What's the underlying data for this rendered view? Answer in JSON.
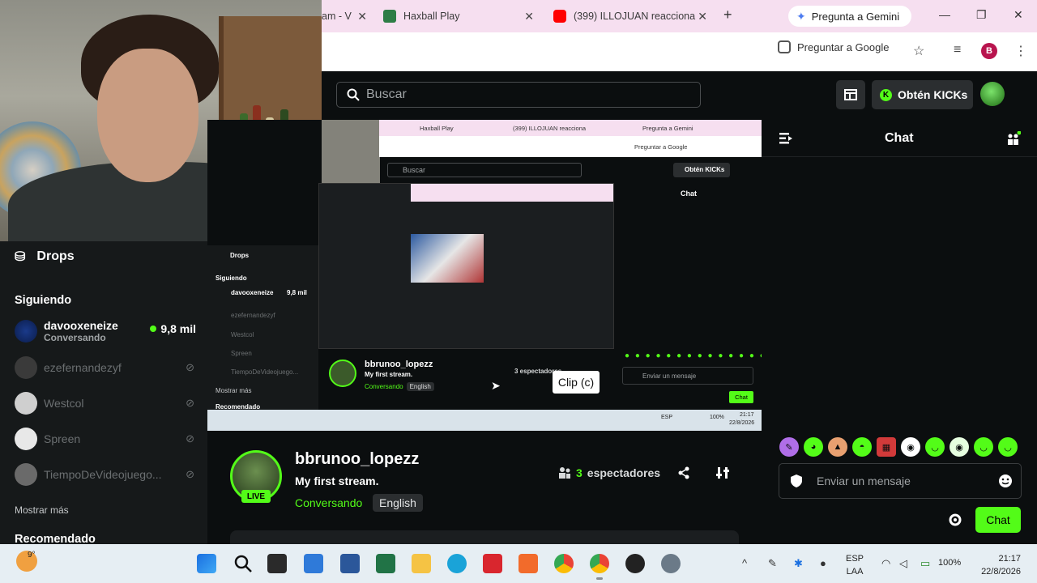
{
  "browser": {
    "tabs": [
      {
        "title": "am - V",
        "favicon_color": "#53fc18"
      },
      {
        "title": "Haxball Play",
        "favicon_color": "#2d7d46"
      },
      {
        "title": "(399) ILLOJUAN reacciona",
        "favicon_color": "#ff0000"
      }
    ],
    "new_tab": "+",
    "gemini": "Pregunta a Gemini",
    "ask_google": "Preguntar a Google",
    "profile_initial": "B"
  },
  "header": {
    "search_placeholder": "Buscar",
    "get_kicks": "Obtén KICKs"
  },
  "sidebar": {
    "drops": "Drops",
    "following_title": "Siguiendo",
    "channels": [
      {
        "name": "davooxeneize",
        "status": "Conversando",
        "viewers": "9,8 mil",
        "live": true
      },
      {
        "name": "ezefernandezyf",
        "live": false
      },
      {
        "name": "Westcol",
        "live": false
      },
      {
        "name": "Spreen",
        "live": false
      },
      {
        "name": "TiempoDeVideojuego...",
        "live": false
      }
    ],
    "show_more": "Mostrar más",
    "recommended_title": "Recomendado"
  },
  "video": {
    "nested_search": "Buscar",
    "nested_kicks": "Obtén KICKs",
    "nested_chat": "Chat",
    "nested_drops": "Drops",
    "nested_following": "Siguiendo",
    "nested_channels": [
      "davooxeneize",
      "ezefernandezyf",
      "Westcol",
      "Spreen",
      "TiempoDeVideojuego..."
    ],
    "nested_viewers": "9,8 mil",
    "nested_show_more": "Mostrar más",
    "nested_recommended": "Recomendado",
    "nested_streamer": "bbrunoo_lopezz",
    "nested_title": "My first stream.",
    "nested_category": "Conversando",
    "nested_lang": "English",
    "nested_viewers_count": "3 espectadores",
    "nested_message": "Enviar un mensaje",
    "nested_chat_btn": "Chat",
    "nested_tabs": [
      "Haxball Play",
      "(399) ILLOJUAN reacciona",
      "Pregunta a Gemini"
    ],
    "nested_ask_google": "Preguntar a Google",
    "clip_tooltip": "Clip (c)",
    "nested_clock": "21:17",
    "nested_date": "22/8/2026",
    "nested_lang_code": "ESP",
    "nested_battery": "100%"
  },
  "stream": {
    "streamer": "bbrunoo_lopezz",
    "live_badge": "LIVE",
    "title": "My first stream.",
    "category": "Conversando",
    "language": "English",
    "viewers_count": "3",
    "viewers_label": "espectadores"
  },
  "chat": {
    "title": "Chat",
    "message_placeholder": "Enviar un mensaje",
    "send": "Chat",
    "emotes": [
      "kick-emote-1",
      "kick-emote-2",
      "kick-emote-3",
      "kick-emote-4",
      "kick-emote-5",
      "kick-emote-6",
      "kick-emote-7",
      "kick-emote-8",
      "kick-emote-9",
      "kick-emote-10"
    ]
  },
  "taskbar": {
    "temperature": "9°",
    "lang_top": "ESP",
    "lang_bottom": "LAA",
    "battery": "100%",
    "time": "21:17",
    "date": "22/8/2026"
  },
  "colors": {
    "accent": "#53fc18",
    "background": "#0b0e0f",
    "sidebar": "#16191a"
  }
}
